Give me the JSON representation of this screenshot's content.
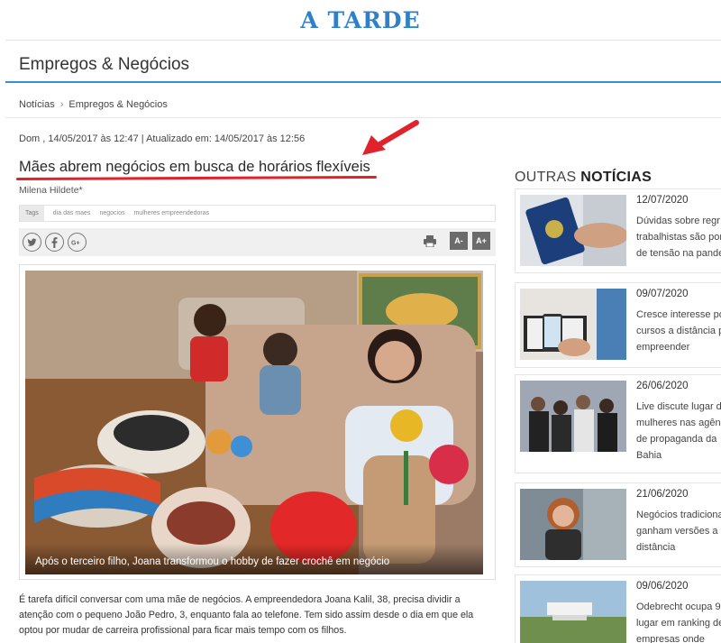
{
  "site": {
    "logo": "A TARDE"
  },
  "section": {
    "title": "Empregos & Negócios"
  },
  "breadcrumb": {
    "items": [
      "Notícias",
      "Empregos & Negócios"
    ],
    "separator": "›"
  },
  "article": {
    "dateline": "Dom , 14/05/2017 às 12:47 | Atualizado em: 14/05/2017 às 12:56",
    "headline": "Mães abrem negócios em busca de horários flexíveis",
    "author": "Milena Hildete*",
    "tags_label": "Tags",
    "tags": [
      "dia das maes",
      "negocios",
      "mulheres empreendedoras"
    ],
    "share_icons": [
      "twitter-icon",
      "facebook-icon",
      "google-plus-icon"
    ],
    "font_decrease": "A-",
    "font_increase": "A+",
    "photo_caption": "Após o terceiro filho, Joana transformou o hobby de fazer crochê em negócio",
    "body": "É tarefa difícil conversar com uma mãe de negócios. A empreendedora Joana Kalil, 38,  precisa dividir a atenção com o pequeno João Pedro, 3, enquanto fala ao telefone. Tem sido assim desde o dia em que ela optou por mudar de carreira profissional  para ficar mais tempo com os filhos."
  },
  "sidebar": {
    "title_prefix": "OUTRAS ",
    "title_bold": "NOTÍCIAS",
    "items": [
      {
        "date": "12/07/2020",
        "title": "Dúvidas sobre regr\ntrabalhistas são por\nde tensão na pande"
      },
      {
        "date": "09/07/2020",
        "title": "Cresce interesse po\ncursos a distância p\nempreender"
      },
      {
        "date": "26/06/2020",
        "title": "Live discute lugar d\nmulheres nas agênc\nde propaganda da\nBahia"
      },
      {
        "date": "21/06/2020",
        "title": "Negócios tradiciona\nganham versões a\ndistância"
      },
      {
        "date": "09/06/2020",
        "title": "Odebrecht ocupa 9\nlugar em ranking de\nempresas onde"
      }
    ]
  },
  "colors": {
    "brand_blue": "#2f80c9",
    "section_rule": "#3d8ed1",
    "annotation_red": "#e0222c"
  }
}
